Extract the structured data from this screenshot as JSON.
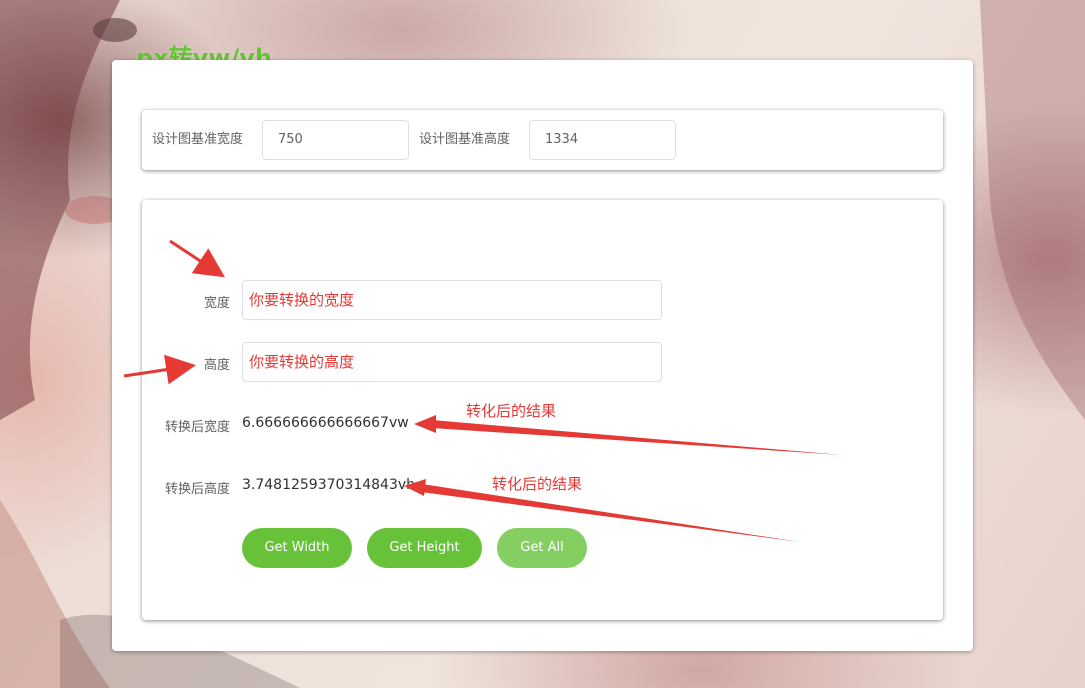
{
  "page": {
    "title": "px转vw/vh"
  },
  "settings": {
    "design_width_label": "设计图基准宽度",
    "design_width_value": "750",
    "design_height_label": "设计图基准高度",
    "design_height_value": "1334"
  },
  "form": {
    "width_label": "宽度",
    "width_placeholder": "你要转换的宽度",
    "height_label": "高度",
    "height_placeholder": "你要转换的高度",
    "result_width_label": "转换后宽度",
    "result_width_value": "6.666666666666667vw",
    "result_height_label": "转换后高度",
    "result_height_value": "3.7481259370314843vh"
  },
  "buttons": {
    "get_width": "Get Width",
    "get_height": "Get Height",
    "get_all": "Get All"
  },
  "annotations": {
    "result_note_1": "转化后的结果",
    "result_note_2": "转化后的结果"
  },
  "colors": {
    "accent_green": "#67c23a",
    "light_green": "#85ce61",
    "annotation_red": "#e53935"
  }
}
